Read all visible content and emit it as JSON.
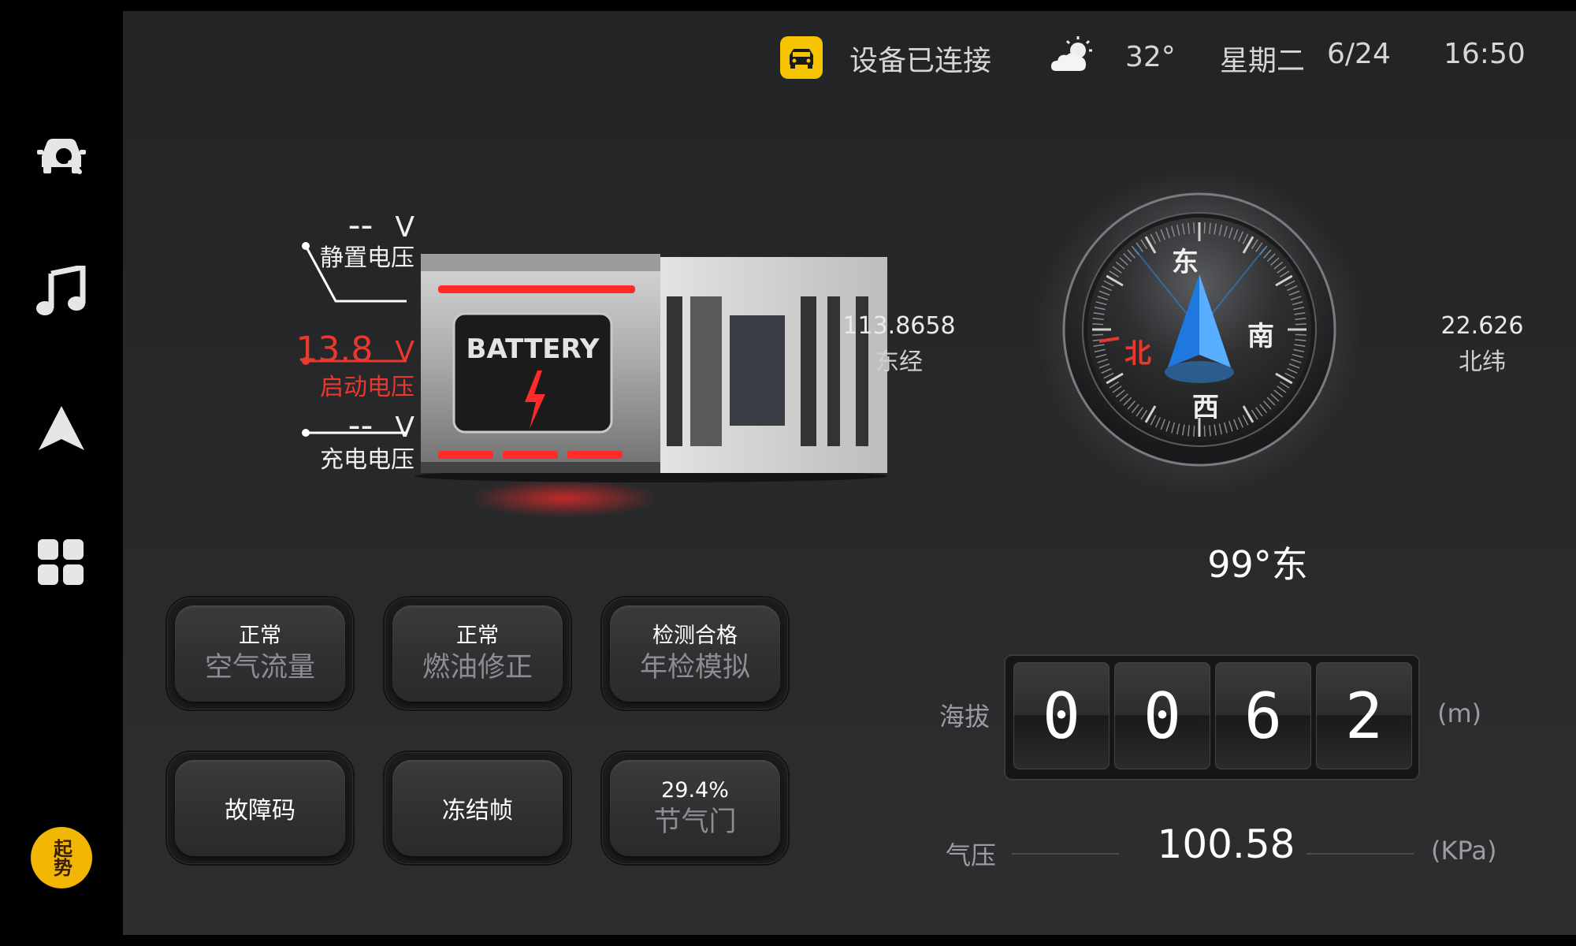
{
  "sidebar": {
    "items": [
      {
        "icon": "car-diagnostic-icon"
      },
      {
        "icon": "music-note-icon"
      },
      {
        "icon": "navigation-arrow-icon"
      },
      {
        "icon": "apps-grid-icon"
      }
    ],
    "logo_text": "起势"
  },
  "status": {
    "connection": "设备已连接",
    "weather_icon": "partly-cloudy-sun-icon",
    "temperature": "32°",
    "weekday": "星期二",
    "date": "6/24",
    "time": "16:50"
  },
  "battery": {
    "image_label": "BATTERY",
    "static": {
      "value": "--",
      "unit": "V",
      "label": "静置电压"
    },
    "start": {
      "value": "13.8",
      "unit": "V",
      "label": "启动电压"
    },
    "charge": {
      "value": "--",
      "unit": "V",
      "label": "充电电压"
    }
  },
  "tiles": [
    {
      "top": "正常",
      "bottom": "空气流量"
    },
    {
      "top": "正常",
      "bottom": "燃油修正"
    },
    {
      "top": "检测合格",
      "bottom": "年检模拟"
    },
    {
      "single": "故障码"
    },
    {
      "single": "冻结帧"
    },
    {
      "top": "29.4%",
      "bottom": "节气门"
    }
  ],
  "compass": {
    "longitude": "113.8658",
    "longitude_label": "东经",
    "latitude": "22.626",
    "latitude_label": "北纬",
    "dir_top": "东",
    "dir_right": "南",
    "dir_bottom": "西",
    "dir_left": "北",
    "heading": "99°东",
    "colors": {
      "north": "#e8382f",
      "needle": "#2d8cf0"
    }
  },
  "altitude": {
    "label": "海拔",
    "digits": [
      "0",
      "0",
      "6",
      "2"
    ],
    "unit": "(m)"
  },
  "pressure": {
    "label": "气压",
    "value": "100.58",
    "unit": "(KPa)"
  }
}
